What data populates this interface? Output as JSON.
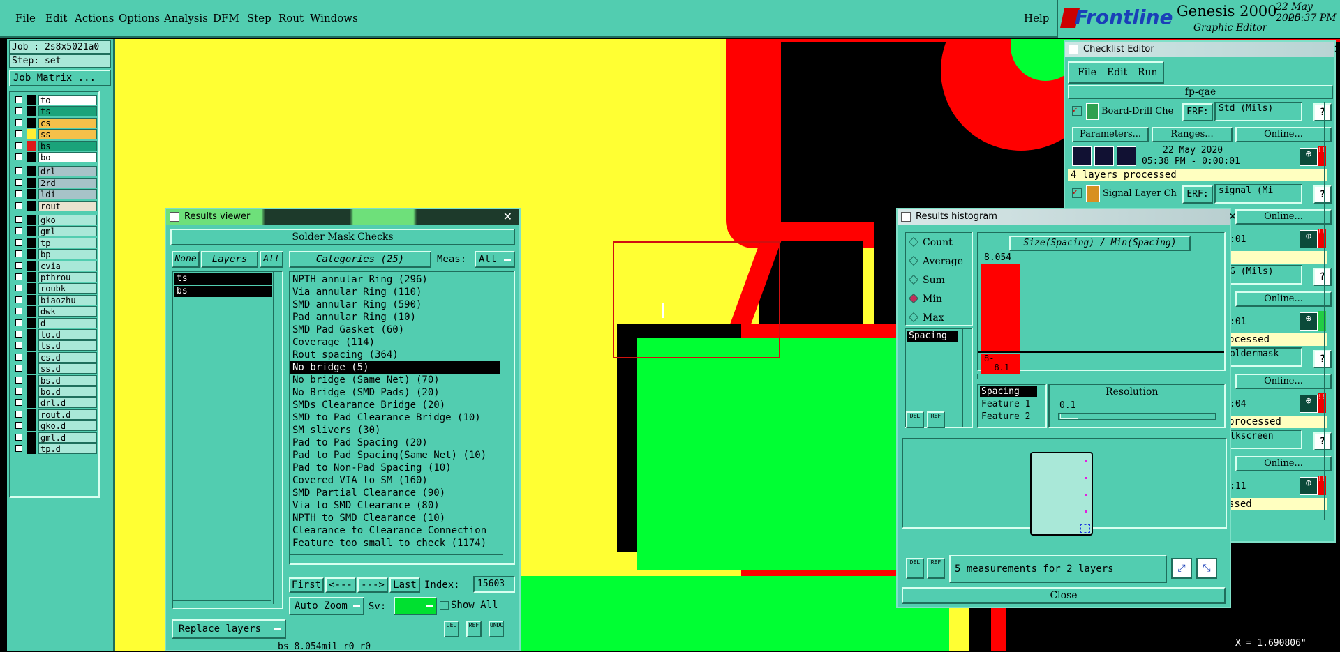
{
  "menu": {
    "items": [
      "File",
      "Edit",
      "Actions",
      "Options",
      "Analysis",
      "DFM",
      "Step",
      "Rout",
      "Windows"
    ],
    "help": "Help"
  },
  "brand": {
    "logo": "Frontline",
    "product": "Genesis 2000",
    "subtitle": "Graphic Editor",
    "date": "22 May 2020",
    "time": "05:37 PM"
  },
  "job": {
    "job_line": "Job : 2s8x5021a0",
    "step_line": "Step: set",
    "matrix_button": "Job Matrix ..."
  },
  "layers": {
    "group1": [
      {
        "name": "to",
        "color": "#000000",
        "bg": "#ffffff"
      },
      {
        "name": "ts",
        "color": "#000000",
        "bg": "#1aa37a"
      },
      {
        "name": "cs",
        "color": "#000000",
        "bg": "#f5c04a"
      },
      {
        "name": "ss",
        "color": "#ffee33",
        "bg": "#f5c04a"
      },
      {
        "name": "bs",
        "color": "#e01818",
        "bg": "#1aa37a"
      },
      {
        "name": "bo",
        "color": "#000000",
        "bg": "#ffffff"
      }
    ],
    "group2": [
      {
        "name": "drl",
        "color": "#000000",
        "bg": "#a7c3c8"
      },
      {
        "name": "2rd",
        "color": "#000000",
        "bg": "#a7c3c8"
      },
      {
        "name": "ldi",
        "color": "#000000",
        "bg": "#a7c3c8"
      },
      {
        "name": "rout",
        "color": "#000000",
        "bg": "#e9e2cf"
      }
    ],
    "group3": [
      "gko",
      "gml",
      "tp",
      "bp",
      "cvia",
      "pthrou",
      "roubk",
      "biaozhu",
      "dwk",
      "d",
      "to.d",
      "ts.d",
      "cs.d",
      "ss.d",
      "bs.d",
      "bo.d",
      "drl.d",
      "rout.d",
      "gko.d",
      "gml.d",
      "tp.d"
    ]
  },
  "results_viewer": {
    "title": "Results viewer",
    "header": "Solder Mask Checks",
    "none_btn": "None",
    "layers_label": "Layers",
    "all_btn": "All",
    "layer_list": [
      "ts",
      "bs"
    ],
    "categories_label": "Categories (25)",
    "meas_label": "Meas:",
    "meas_value": "All",
    "categories": [
      "NPTH annular Ring (296)",
      "Via annular Ring (110)",
      "SMD annular Ring (590)",
      "Pad annular Ring (10)",
      "SMD Pad Gasket (60)",
      "Coverage (114)",
      "Rout spacing (364)",
      "No bridge (5)",
      "No bridge (Same Net) (70)",
      "No Bridge (SMD Pads) (20)",
      "SMDs Clearance Bridge (20)",
      "SMD to Pad Clearance Bridge (10)",
      "SM slivers (30)",
      "Pad to Pad Spacing (20)",
      "Pad to Pad Spacing(Same Net) (10)",
      "Pad to Non-Pad Spacing (10)",
      "Covered VIA to SM (160)",
      "SMD Partial Clearance (90)",
      "Via to SMD Clearance (80)",
      "NPTH to SMD Clearance (10)",
      "Clearance to Clearance Connection",
      "Feature too small to check (1174)"
    ],
    "selected_index": 7,
    "nav": {
      "first": "First",
      "prev": "<---",
      "next": "--->",
      "last": "Last",
      "index_label": "Index:",
      "index_value": "15603"
    },
    "auto_zoom": "Auto Zoom",
    "sv_label": "Sv:",
    "show_all": "Show All",
    "replace_layers": "Replace layers",
    "del": "DEL",
    "ref": "REF",
    "undo": "UNDO",
    "status": "bs 8.054mil r0 r0"
  },
  "checklist": {
    "title": "Checklist Editor",
    "menu": [
      "File",
      "Edit",
      "Run"
    ],
    "name": "fp-qae",
    "check1": {
      "label": "Board-Drill Che",
      "erf": "ERF:",
      "param": "Std (Mils)",
      "date": "22 May 2020",
      "time": "05:38 PM - 0:00:01",
      "status": "4 layers processed"
    },
    "check2": {
      "label": "Signal Layer Ch",
      "erf": "ERF:",
      "param": "signal (Mi"
    },
    "buttons": {
      "parameters": "Parameters...",
      "ranges": "Ranges...",
      "online": "Online..."
    },
    "hidden_rows": [
      ":01",
      "G (Mils)",
      ":01",
      "ocessed",
      "oldermask",
      ":04",
      "processed",
      "lkscreen",
      ":11",
      "ssed"
    ],
    "help": "?"
  },
  "histogram": {
    "title": "Results histogram",
    "modes": [
      "Count",
      "Average",
      "Sum",
      "Min",
      "Max"
    ],
    "selected_mode": "Min",
    "list_item": "Spacing",
    "chart_title": "Size(Spacing) / Min(Spacing)",
    "bar_value": "8.054",
    "bar_range": "8-\n  8.1",
    "feature_list": [
      "Spacing",
      "Feature 1",
      "Feature 2"
    ],
    "resolution_label": "Resolution",
    "resolution_value": "0.1",
    "del": "DEL",
    "ref": "REF",
    "status": "5 measurements for 2 layers",
    "close": "Close"
  },
  "coord": {
    "x_readout": "X = 1.690806\""
  },
  "colors": {
    "teal": "#52cdb0",
    "yellow": "#ffff33",
    "red": "#ff0000",
    "green": "#00ff33",
    "black": "#000000"
  },
  "chart_data": {
    "type": "bar",
    "title": "Size(Spacing) / Min(Spacing)",
    "categories": [
      "8-8.1"
    ],
    "values": [
      8.054
    ]
  }
}
